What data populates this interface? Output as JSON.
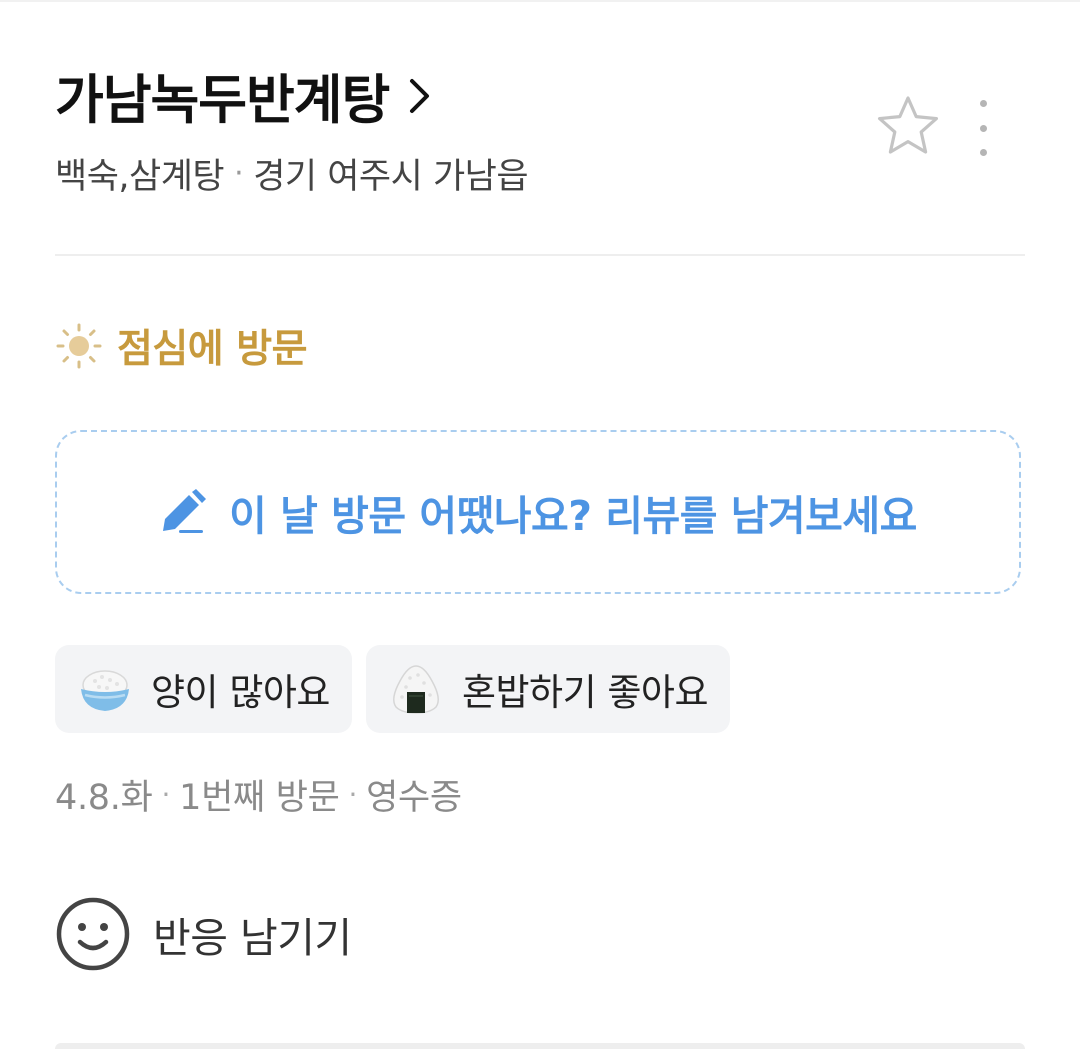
{
  "restaurant": {
    "name": "가남녹두반계탕",
    "category": "백숙,삼계탕",
    "location": "경기 여주시 가남읍"
  },
  "visit": {
    "time_label": "점심에 방문"
  },
  "review_prompt": {
    "text": "이 날 방문 어땠나요? 리뷰를 남겨보세요"
  },
  "tags": [
    {
      "label": "양이 많아요",
      "icon": "rice-bowl-icon"
    },
    {
      "label": "혼밥하기 좋아요",
      "icon": "rice-ball-icon"
    }
  ],
  "meta": {
    "date": "4.8.화",
    "visit_count": "1번째 방문",
    "verification": "영수증"
  },
  "reaction": {
    "label": "반응 남기기"
  },
  "colors": {
    "accent_blue": "#4d94e3",
    "dashed_border": "#a9cdef",
    "visit_gold": "#c79a3d"
  }
}
